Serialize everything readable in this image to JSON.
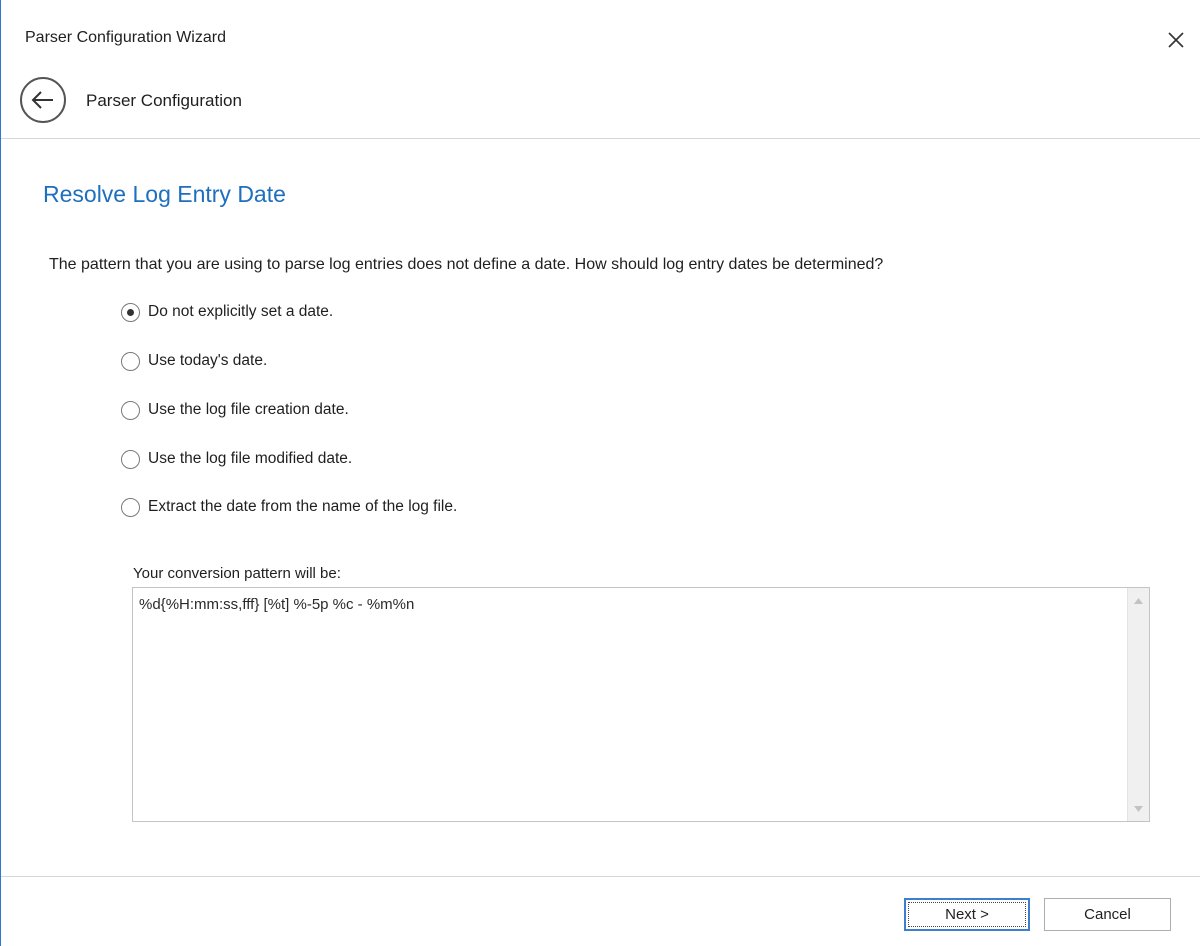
{
  "window": {
    "title": "Parser Configuration Wizard",
    "close_icon": "close-icon",
    "accent_color": "#2b79d4"
  },
  "nav": {
    "back_icon": "back-arrow-icon",
    "label": "Parser Configuration"
  },
  "page": {
    "heading": "Resolve Log Entry Date",
    "heading_color": "#1e6fbf",
    "question": "The pattern that you are using to parse log entries does not define a date.  How should log entry dates be determined?"
  },
  "options": [
    {
      "label": "Do not explicitly set a date.",
      "selected": true
    },
    {
      "label": "Use today's date.",
      "selected": false
    },
    {
      "label": "Use the log file creation date.",
      "selected": false
    },
    {
      "label": "Use the log file modified date.",
      "selected": false
    },
    {
      "label": "Extract the date from the name of the log file.",
      "selected": false
    }
  ],
  "pattern": {
    "label": "Your conversion pattern will be:",
    "value": "%d{%H:mm:ss,fff} [%t] %-5p %c - %m%n"
  },
  "buttons": {
    "next": "Next >",
    "cancel": "Cancel"
  }
}
